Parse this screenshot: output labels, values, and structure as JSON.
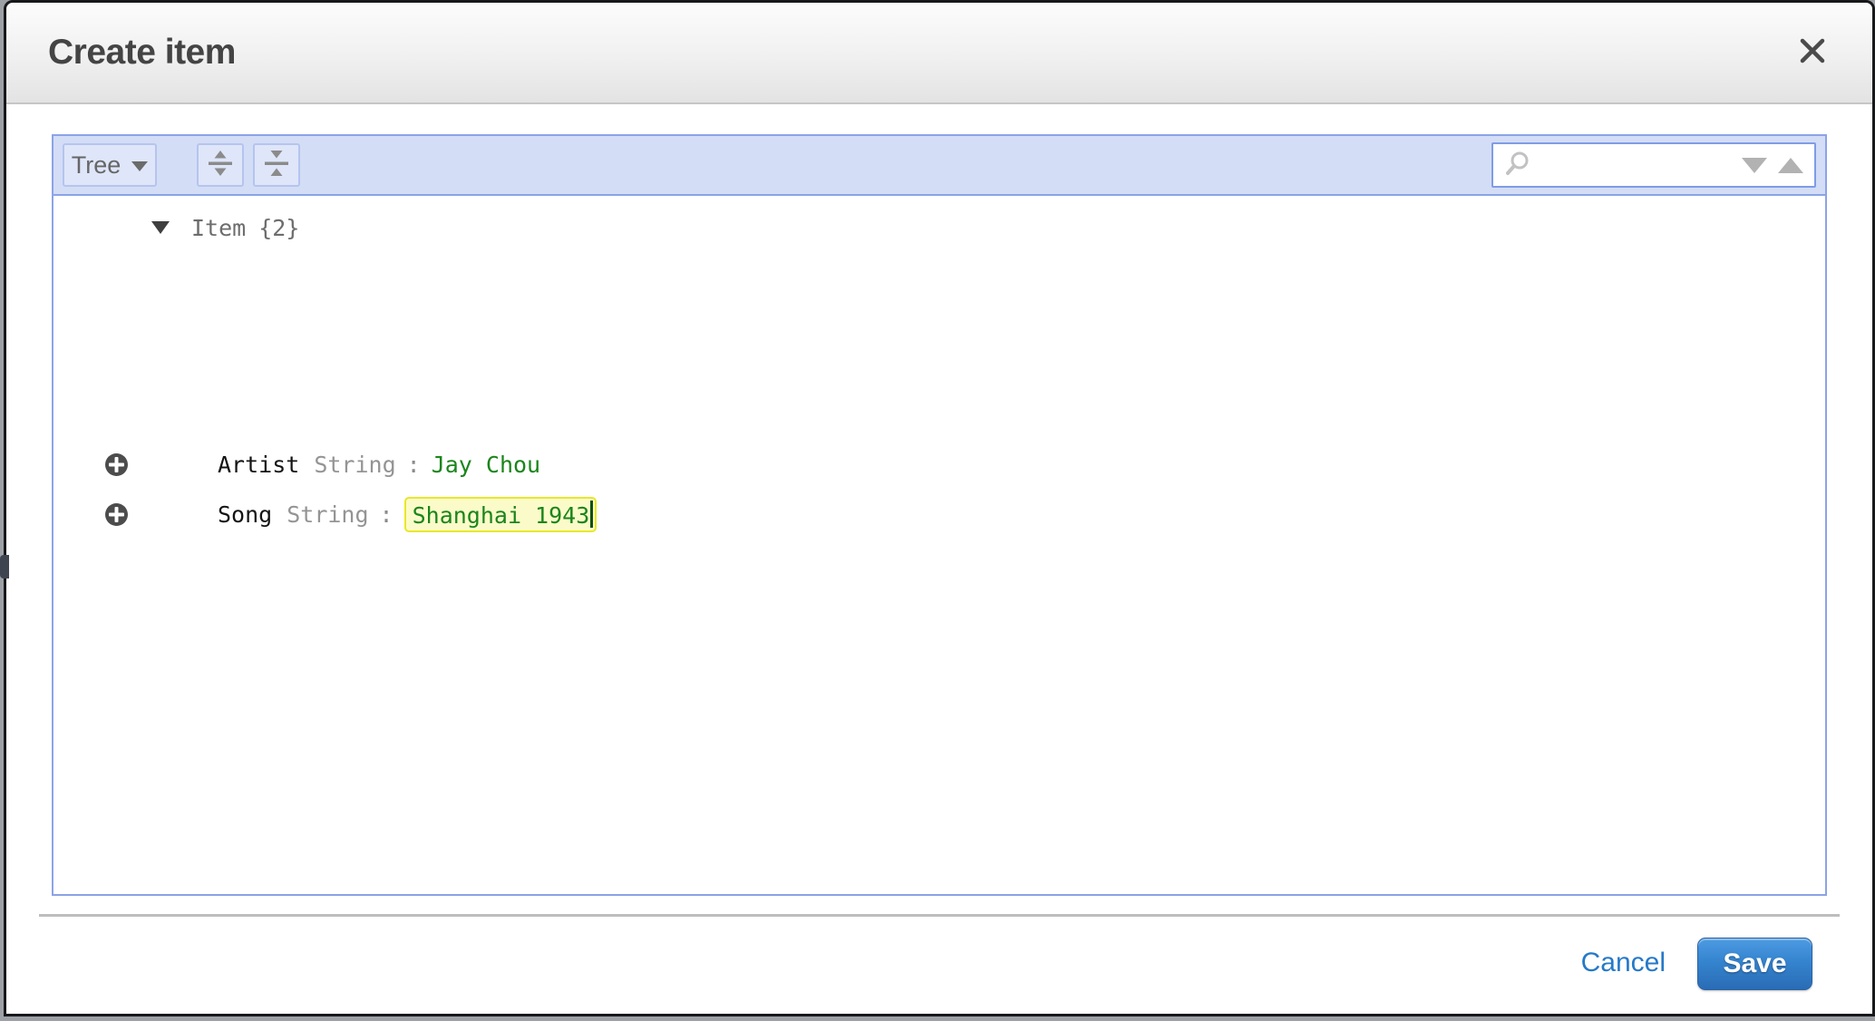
{
  "modal": {
    "title": "Create item"
  },
  "toolbar": {
    "view_selector_label": "Tree",
    "search": {
      "value": "",
      "placeholder": ""
    }
  },
  "tree": {
    "root_label": "Item",
    "root_badge": "{2}",
    "rows": [
      {
        "name": "Artist",
        "type": "String",
        "colon": ":",
        "value": "Jay Chou"
      },
      {
        "name": "Song",
        "type": "String",
        "colon": ":",
        "value": "Shanghai 1943"
      }
    ]
  },
  "footer": {
    "cancel_label": "Cancel",
    "save_label": "Save"
  },
  "colors": {
    "accent_green": "#1b851b",
    "highlight_bg": "#fbfbc9",
    "highlight_border": "#e8e82a",
    "toolbar_bg": "#d4ddf6",
    "panel_border": "#8ba4e6",
    "cancel_link": "#2579c8",
    "save_button": "#3584cf"
  }
}
